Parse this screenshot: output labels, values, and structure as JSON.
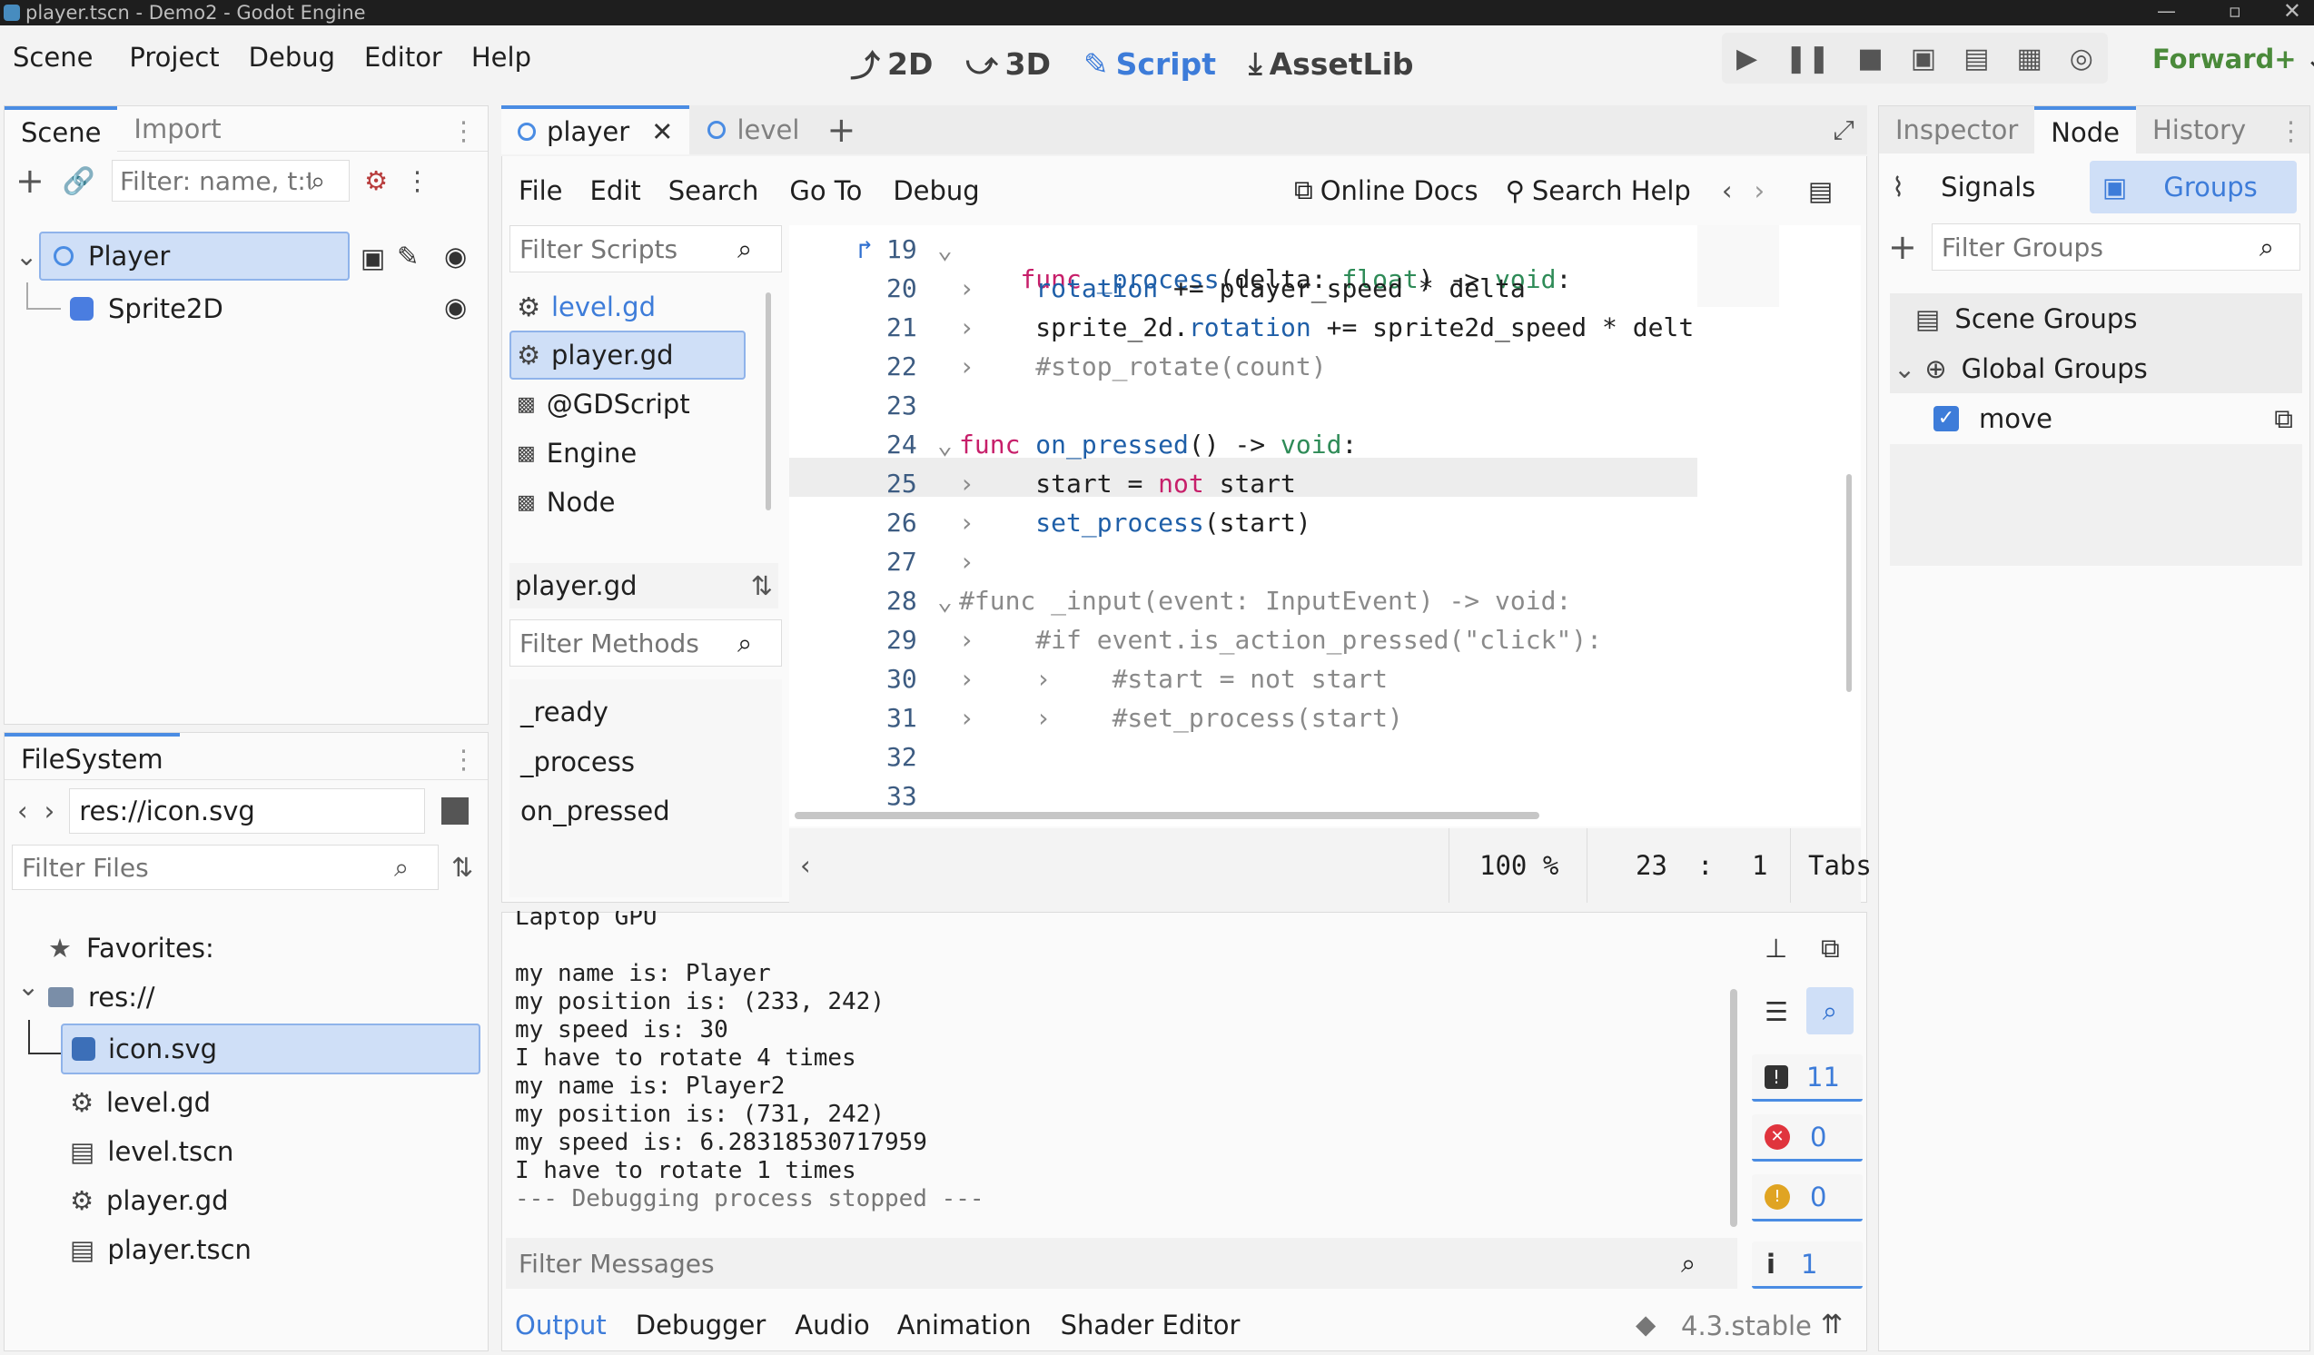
{
  "window": {
    "title": "player.tscn - Demo2 - Godot Engine"
  },
  "menu": [
    "Scene",
    "Project",
    "Debug",
    "Editor",
    "Help"
  ],
  "workspaces": {
    "d2": "2D",
    "d3": "3D",
    "script": "Script",
    "assetlib": "AssetLib"
  },
  "renderer": "Forward+",
  "scene_dock": {
    "tabs": [
      "Scene",
      "Import"
    ],
    "filter_placeholder": "Filter: name, t:t",
    "tree": [
      {
        "label": "Player"
      },
      {
        "label": "Sprite2D"
      }
    ]
  },
  "filesystem": {
    "tab": "FileSystem",
    "path": "res://icon.svg",
    "filter_placeholder": "Filter Files",
    "favorites": "Favorites:",
    "root": "res://",
    "files": [
      "icon.svg",
      "level.gd",
      "level.tscn",
      "player.gd",
      "player.tscn"
    ]
  },
  "script_editor": {
    "tabs": [
      "player",
      "level"
    ],
    "menu": [
      "File",
      "Edit",
      "Search",
      "Go To",
      "Debug"
    ],
    "online_docs": "Online Docs",
    "search_help": "Search Help",
    "filter_scripts": "Filter Scripts",
    "scripts": [
      "level.gd",
      "player.gd",
      "@GDScript",
      "Engine",
      "Node"
    ],
    "current_script": "player.gd",
    "filter_methods": "Filter Methods",
    "methods": [
      "_ready",
      "_process",
      "on_pressed"
    ],
    "zoom": "100 %",
    "line": "23",
    "sep": ":",
    "col": "1",
    "indent": "Tabs"
  },
  "code": {
    "numbers": [
      "19",
      "20",
      "21",
      "22",
      "23",
      "24",
      "25",
      "26",
      "27",
      "28",
      "29",
      "30",
      "31",
      "32",
      "33"
    ],
    "l19": {
      "kw": "func",
      "name": "_process",
      "a": "(delta: ",
      "ty": "float",
      "b": ") -> ",
      "ret": "void",
      ":": ":"
    },
    "l20": {
      "a": "rotation",
      "b": " += player_speed * delta"
    },
    "l21": {
      "a": "sprite_2d.",
      "b": "rotation",
      "c": " += sprite2d_speed * delt"
    },
    "l22": "#stop_rotate(count)",
    "l24": {
      "kw": "func",
      "name": "on_pressed",
      "a": "() -> ",
      "ret": "void",
      ":": ":"
    },
    "l25": {
      "a": "start = ",
      "kw": "not",
      "b": " start"
    },
    "l26": {
      "name": "set_process",
      "a": "(start)"
    },
    "l28": "#func _input(event: InputEvent) -> void:",
    "l29": "#if event.is_action_pressed(\"click\"):",
    "l30": "#start = not start",
    "l31": "#set_process(start)"
  },
  "output": {
    "lines": [
      "Laptop GPU",
      "",
      "my name is: Player",
      "my position is: (233, 242)",
      "my speed is: 30",
      "I have to rotate 4 times",
      "my name is: Player2",
      "my position is: (731, 242)",
      "my speed is: 6.28318530717959",
      "I have to rotate 1 times",
      "--- Debugging process stopped ---"
    ],
    "filter_placeholder": "Filter Messages",
    "counts": {
      "messages": "11",
      "errors": "0",
      "warnings": "0",
      "editor": "1"
    }
  },
  "bottom_tabs": [
    "Output",
    "Debugger",
    "Audio",
    "Animation",
    "Shader Editor"
  ],
  "version": "4.3.stable",
  "inspector": {
    "tabs": [
      "Inspector",
      "Node",
      "History"
    ],
    "subtabs": {
      "signals": "Signals",
      "groups": "Groups"
    },
    "filter_placeholder": "Filter Groups",
    "scene_groups": "Scene Groups",
    "global_groups": "Global Groups",
    "group_item": "move"
  },
  "colors": {
    "accent": "#3d7cd9",
    "keyword": "#c71f6a",
    "function": "#1f5fa8",
    "comment": "#8a8a8a",
    "error": "#e0343d",
    "warning": "#e0a422"
  }
}
